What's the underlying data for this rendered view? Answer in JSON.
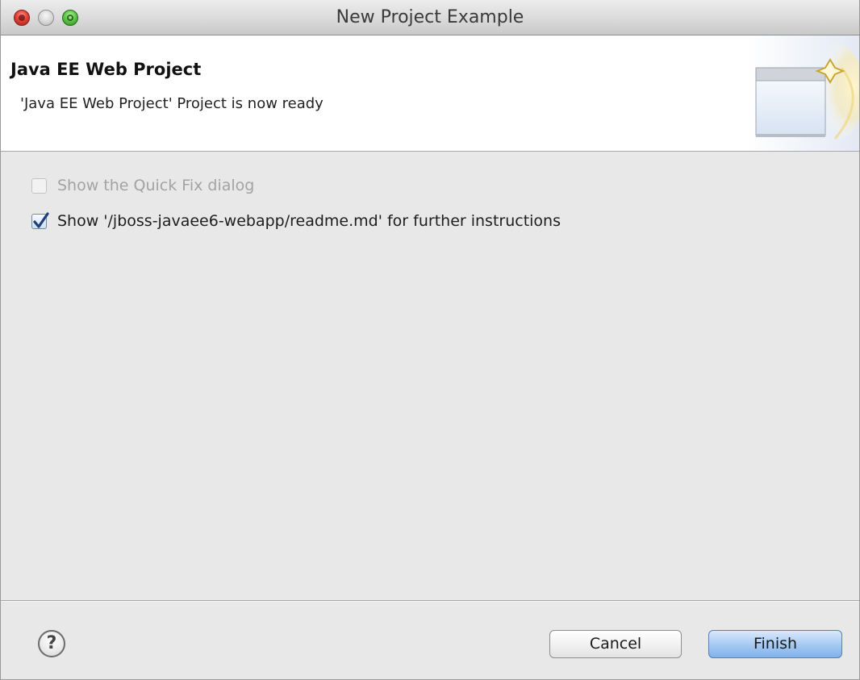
{
  "window": {
    "title": "New Project Example"
  },
  "banner": {
    "title": "Java EE Web Project",
    "message": "'Java EE Web Project' Project is now ready",
    "graphic": "wizard-window-sparkle-icon"
  },
  "options": [
    {
      "label": "Show the Quick Fix dialog",
      "checked": false,
      "enabled": false
    },
    {
      "label": "Show '/jboss-javaee6-webapp/readme.md' for further instructions",
      "checked": true,
      "enabled": true
    }
  ],
  "footer": {
    "help_label": "?",
    "cancel_label": "Cancel",
    "finish_label": "Finish"
  },
  "colors": {
    "close": "#e0453a",
    "zoom": "#5dc94a",
    "default_button": "#a8ccf3"
  }
}
